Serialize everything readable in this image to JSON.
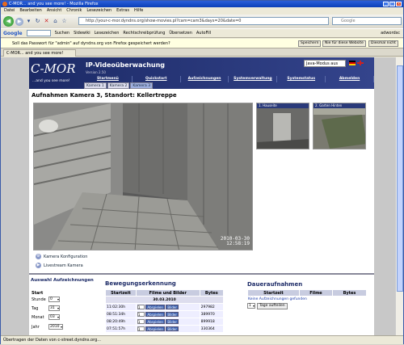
{
  "window": {
    "title": "C-MOR... and you see more! - Mozilla Firefox"
  },
  "menu": [
    "Datei",
    "Bearbeiten",
    "Ansicht",
    "Chronik",
    "Lesezeichen",
    "Extras",
    "Hilfe"
  ],
  "nav": {
    "url": "http://your-c-mor.dyndns.org/show-movies.pl?cam=cam3&days=20&date=0",
    "search_placeholder": "Google"
  },
  "gtoolbar": {
    "logo": "Google",
    "search_label": "Suchen",
    "items": [
      "Sidewiki",
      "Lesezeichen",
      "Rechtschreibprüfung",
      "Übersetzen",
      "AutoFill"
    ],
    "account": "adwordsc"
  },
  "notification": {
    "text": "Soll das Passwort für \"admin\" auf dyndns.org von Firefox gespeichert werden?",
    "save": "Speichern",
    "never": "Nie für diese Website",
    "not_now": "Diesmal nicht"
  },
  "tab": {
    "label": "C-MOR... and you see more!"
  },
  "app": {
    "logo": "C-MOR",
    "slogan": "...and you see more!",
    "title": "IP-Videoüberwachung",
    "version": "Version 2.50",
    "mode": "Java-Modus aus",
    "nav": [
      "Startmenü",
      "Quickstart",
      "Aufzeichnungen",
      "Systemverwaltung",
      "Systemstatus",
      "Abmelden"
    ],
    "subtabs": [
      "Kamera 1",
      "Kamera 2",
      "Kamera 3"
    ]
  },
  "main": {
    "title": "Aufnahmen Kamera 3, Standort: Kellertreppe",
    "stamp_date": "2010-03-30",
    "stamp_time": "12:58:19",
    "thumbs": [
      "1. Hauseite",
      "2. Garten Hinten"
    ],
    "camlinks": [
      "Kamera Konfiguration",
      "Livestream Kamera"
    ]
  },
  "archive": {
    "title": "Auswahl Aufzeichnungen",
    "start": "Start",
    "fields": [
      {
        "label": "Stunde",
        "value": "0"
      },
      {
        "label": "Tag",
        "value": "31"
      },
      {
        "label": "Monat",
        "value": "03"
      },
      {
        "label": "Jahr",
        "value": "2010"
      }
    ]
  },
  "motion": {
    "title": "Bewegungserkennung",
    "headers": [
      "Startzeit",
      "Filme und Bilder",
      "Bytes"
    ],
    "date": "30.03.2010",
    "rows": [
      {
        "time": "11:02:30h",
        "bytes": "297982"
      },
      {
        "time": "08:51:34h",
        "bytes": "389970"
      },
      {
        "time": "08:20:49h",
        "bytes": "899918"
      },
      {
        "time": "07:51:57h",
        "bytes": "330364"
      }
    ],
    "play": "Abspielen",
    "images": "Bilder"
  },
  "continuous": {
    "title": "Daueraufnahmen",
    "headers": [
      "Startzeit",
      "Filme",
      "Bytes"
    ],
    "empty": "Keine Aufzeichnungen gefunden",
    "select_value": "1",
    "button": "Tage aufteilen"
  },
  "statusbar": {
    "text": "Übertragen der Daten von c-street.dyndns.org..."
  }
}
